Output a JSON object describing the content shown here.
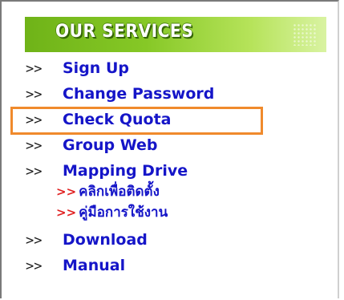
{
  "header": {
    "title": "OUR SERVICES"
  },
  "menu": {
    "arrow": ">>",
    "items": [
      {
        "label": "Sign Up"
      },
      {
        "label": "Change Password"
      },
      {
        "label": "Check Quota"
      },
      {
        "label": "Group Web"
      },
      {
        "label": "Mapping Drive"
      },
      {
        "label": "Download"
      },
      {
        "label": "Manual"
      }
    ],
    "mapping_sub": {
      "arrow": ">>",
      "items": [
        {
          "label": "คลิกเพื่อติดตั้ง"
        },
        {
          "label": "คู่มือการใช้งาน"
        }
      ]
    }
  },
  "colors": {
    "link": "#1515c8",
    "sub_arrow": "#e02020",
    "highlight": "#f08a2c",
    "header_green": "#7bbd1f"
  },
  "highlighted_item": "Check Quota"
}
